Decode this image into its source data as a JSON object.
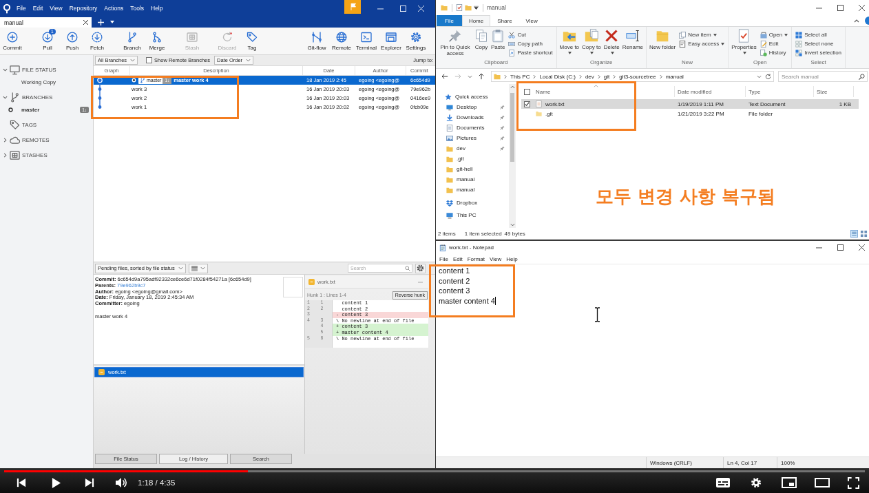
{
  "sourcetree": {
    "menu": [
      "File",
      "Edit",
      "View",
      "Repository",
      "Actions",
      "Tools",
      "Help"
    ],
    "tabs": [
      {
        "label": "manual",
        "selected": true
      }
    ],
    "toolbar_left": [
      {
        "label": "Commit",
        "disabled": false
      },
      {
        "label": "Pull",
        "disabled": false,
        "badge": "1"
      },
      {
        "label": "Push",
        "disabled": false
      },
      {
        "label": "Fetch",
        "disabled": false
      },
      {
        "label": "Branch",
        "disabled": false
      },
      {
        "label": "Merge",
        "disabled": false
      },
      {
        "label": "Stash",
        "disabled": true
      },
      {
        "label": "Discard",
        "disabled": true
      },
      {
        "label": "Tag",
        "disabled": false
      }
    ],
    "toolbar_right": [
      {
        "label": "Git-flow"
      },
      {
        "label": "Remote"
      },
      {
        "label": "Terminal"
      },
      {
        "label": "Explorer"
      },
      {
        "label": "Settings"
      }
    ],
    "sidebar": [
      {
        "label": "FILE STATUS",
        "expanded": true,
        "children": [
          {
            "label": "Working Copy",
            "selected": false,
            "current": false
          }
        ]
      },
      {
        "label": "BRANCHES",
        "expanded": true,
        "children": [
          {
            "label": "master",
            "selected": false,
            "current": true,
            "badge": "1↓"
          }
        ]
      },
      {
        "label": "TAGS"
      },
      {
        "label": "REMOTES",
        "expanded": false
      },
      {
        "label": "STASHES",
        "expanded": false
      }
    ],
    "filters": {
      "branches": "All Branches",
      "remote_checkbox": {
        "label": "Show Remote Branches",
        "checked": false
      },
      "order": "Date Order",
      "jump_label": "Jump to:"
    },
    "history": {
      "columns": [
        "Graph",
        "Description",
        "Date",
        "Author",
        "Commit"
      ],
      "rows": [
        {
          "selected": true,
          "head": true,
          "branch": "master",
          "branch_badge": "1↓",
          "description": "master work 4",
          "date": "18 Jan 2019 2:45",
          "author": "egoing <egoing@",
          "commit": "6c654d9"
        },
        {
          "selected": false,
          "head": false,
          "description": "work 3",
          "date": "16 Jan 2019 20:03",
          "author": "egoing <egoing@",
          "commit": "79e962b"
        },
        {
          "selected": false,
          "head": false,
          "description": "work 2",
          "date": "16 Jan 2019 20:03",
          "author": "egoing <egoing@",
          "commit": "0416ee9"
        },
        {
          "selected": false,
          "head": false,
          "description": "work 1",
          "date": "16 Jan 2019 20:02",
          "author": "egoing <egoing@",
          "commit": "0fcb09e"
        }
      ]
    },
    "file_toolbar": {
      "sort": "Pending files, sorted by file status",
      "search_placeholder": "Search"
    },
    "commit_details": {
      "fields": [
        {
          "kind": "text",
          "label": "Commit:",
          "value": "6c654d9a795adf92332ce6ce6d71f0284f54271a [6c654d9]"
        },
        {
          "kind": "link",
          "label": "Parents:",
          "value": "79e962b9c7"
        },
        {
          "kind": "text",
          "label": "Author:",
          "value": "egoing <egoing@gmail.com>"
        },
        {
          "kind": "text",
          "label": "Date:",
          "value": "Friday, January 18, 2019 2:45:34 AM"
        },
        {
          "kind": "text",
          "label": "Committer:",
          "value": "egoing"
        }
      ],
      "message": "master work 4"
    },
    "changed_files": [
      {
        "name": "work.txt",
        "selected": true
      }
    ],
    "diff": {
      "file": "work.txt",
      "hunk": "Hunk 1 : Lines 1-4",
      "button": "Reverse hunk",
      "lines": [
        {
          "kind": "context",
          "old": "1",
          "new": "1",
          "text": "content 1"
        },
        {
          "kind": "context",
          "old": "2",
          "new": "2",
          "text": "content 2"
        },
        {
          "kind": "removed",
          "old": "3",
          "sign": "-",
          "text": "content 3"
        },
        {
          "kind": "context",
          "old": "4",
          "new": "3",
          "sign": "\\",
          "text": "No newline at end of file"
        },
        {
          "kind": "added",
          "new": "4",
          "sign": "+",
          "text": "content 3"
        },
        {
          "kind": "added",
          "new": "5",
          "sign": "+",
          "text": "master content 4"
        },
        {
          "kind": "context",
          "old": "5",
          "new": "6",
          "sign": "\\",
          "text": "No newline at end of file"
        }
      ]
    },
    "bottom_tabs": [
      {
        "label": "File Status",
        "selected": false
      },
      {
        "label": "Log / History",
        "selected": true
      },
      {
        "label": "Search",
        "selected": false
      }
    ]
  },
  "explorer": {
    "title": "manual",
    "ribbon_tabs": [
      {
        "label": "File",
        "kind": "menu",
        "selected": false
      },
      {
        "label": "Home",
        "kind": "tab",
        "selected": true
      },
      {
        "label": "Share",
        "kind": "tab",
        "selected": false
      },
      {
        "label": "View",
        "kind": "tab",
        "selected": false
      }
    ],
    "ribbon_groups": [
      {
        "label": "Clipboard",
        "items": [
          {
            "kind": "large",
            "label": "Pin to Quick access",
            "dropdown": false
          },
          {
            "kind": "large",
            "label": "Copy",
            "dropdown": false
          },
          {
            "kind": "large",
            "label": "Paste",
            "dropdown": false
          },
          {
            "kind": "small",
            "label": "Cut",
            "dropdown": false
          },
          {
            "kind": "small",
            "label": "Copy path",
            "dropdown": false
          },
          {
            "kind": "small",
            "label": "Paste shortcut",
            "dropdown": false
          }
        ]
      },
      {
        "label": "Organize",
        "items": [
          {
            "kind": "large",
            "label": "Move to",
            "dropdown": true
          },
          {
            "kind": "large",
            "label": "Copy to",
            "dropdown": true
          },
          {
            "kind": "large",
            "label": "Delete",
            "dropdown": true
          },
          {
            "kind": "large",
            "label": "Rename",
            "dropdown": false
          }
        ]
      },
      {
        "label": "New",
        "items": [
          {
            "kind": "large",
            "label": "New folder",
            "dropdown": false
          },
          {
            "kind": "small",
            "label": "New item",
            "dropdown": true
          },
          {
            "kind": "small",
            "label": "Easy access",
            "dropdown": true
          }
        ]
      },
      {
        "label": "Open",
        "items": [
          {
            "kind": "large",
            "label": "Properties",
            "dropdown": true
          },
          {
            "kind": "small",
            "label": "Open",
            "dropdown": true
          },
          {
            "kind": "small",
            "label": "Edit",
            "dropdown": false
          },
          {
            "kind": "small",
            "label": "History",
            "dropdown": false
          }
        ]
      },
      {
        "label": "Select",
        "items": [
          {
            "kind": "small",
            "label": "Select all",
            "dropdown": false
          },
          {
            "kind": "small",
            "label": "Select none",
            "dropdown": false
          },
          {
            "kind": "small",
            "label": "Invert selection",
            "dropdown": false
          }
        ]
      }
    ],
    "path": [
      "This PC",
      "Local Disk (C:)",
      "dev",
      "git",
      "git3-sourcetree",
      "manual"
    ],
    "search_placeholder": "Search manual",
    "nav_pane": [
      {
        "kind": "star",
        "label": "Quick access",
        "pinned": false
      },
      {
        "kind": "desktop",
        "label": "Desktop",
        "pinned": true
      },
      {
        "kind": "download",
        "label": "Downloads",
        "pinned": true
      },
      {
        "kind": "document",
        "label": "Documents",
        "pinned": true
      },
      {
        "kind": "picture",
        "label": "Pictures",
        "pinned": true
      },
      {
        "kind": "folder",
        "label": "dev",
        "pinned": true
      },
      {
        "kind": "folder",
        "label": ".git",
        "pinned": false
      },
      {
        "kind": "folder",
        "label": "git-hell",
        "pinned": false
      },
      {
        "kind": "folder",
        "label": "manual",
        "pinned": false
      },
      {
        "kind": "folder",
        "label": "manual",
        "pinned": false
      },
      {
        "kind": "dropbox",
        "label": "Dropbox",
        "pinned": false
      },
      {
        "kind": "pc",
        "label": "This PC",
        "pinned": false
      }
    ],
    "header_checkbox": {
      "checked": false
    },
    "columns": [
      "Name",
      "Date modified",
      "Type",
      "Size"
    ],
    "files": [
      {
        "kind": "text",
        "name": "work.txt",
        "modified": "1/19/2019 1:11 PM",
        "type": "Text Document",
        "size": "1 KB",
        "selected": true
      },
      {
        "kind": "folder",
        "name": ".git",
        "modified": "1/21/2019 3:22 PM",
        "type": "File folder",
        "selected": false
      }
    ],
    "status": [
      "2 items",
      "1 item selected",
      "49 bytes"
    ]
  },
  "notepad": {
    "title": "work.txt - Notepad",
    "menu": [
      "File",
      "Edit",
      "Format",
      "View",
      "Help"
    ],
    "text": "content 1\ncontent 2\ncontent 3\nmaster content 4",
    "status": [
      "Windows (CRLF)",
      "Ln 4, Col 17",
      "100%"
    ]
  },
  "annotation": {
    "caption": "모두 변경 사항 복구됨"
  },
  "video_player": {
    "playing": false,
    "progress": {
      "level": 0.283
    },
    "time": "1:18 / 4:35"
  }
}
